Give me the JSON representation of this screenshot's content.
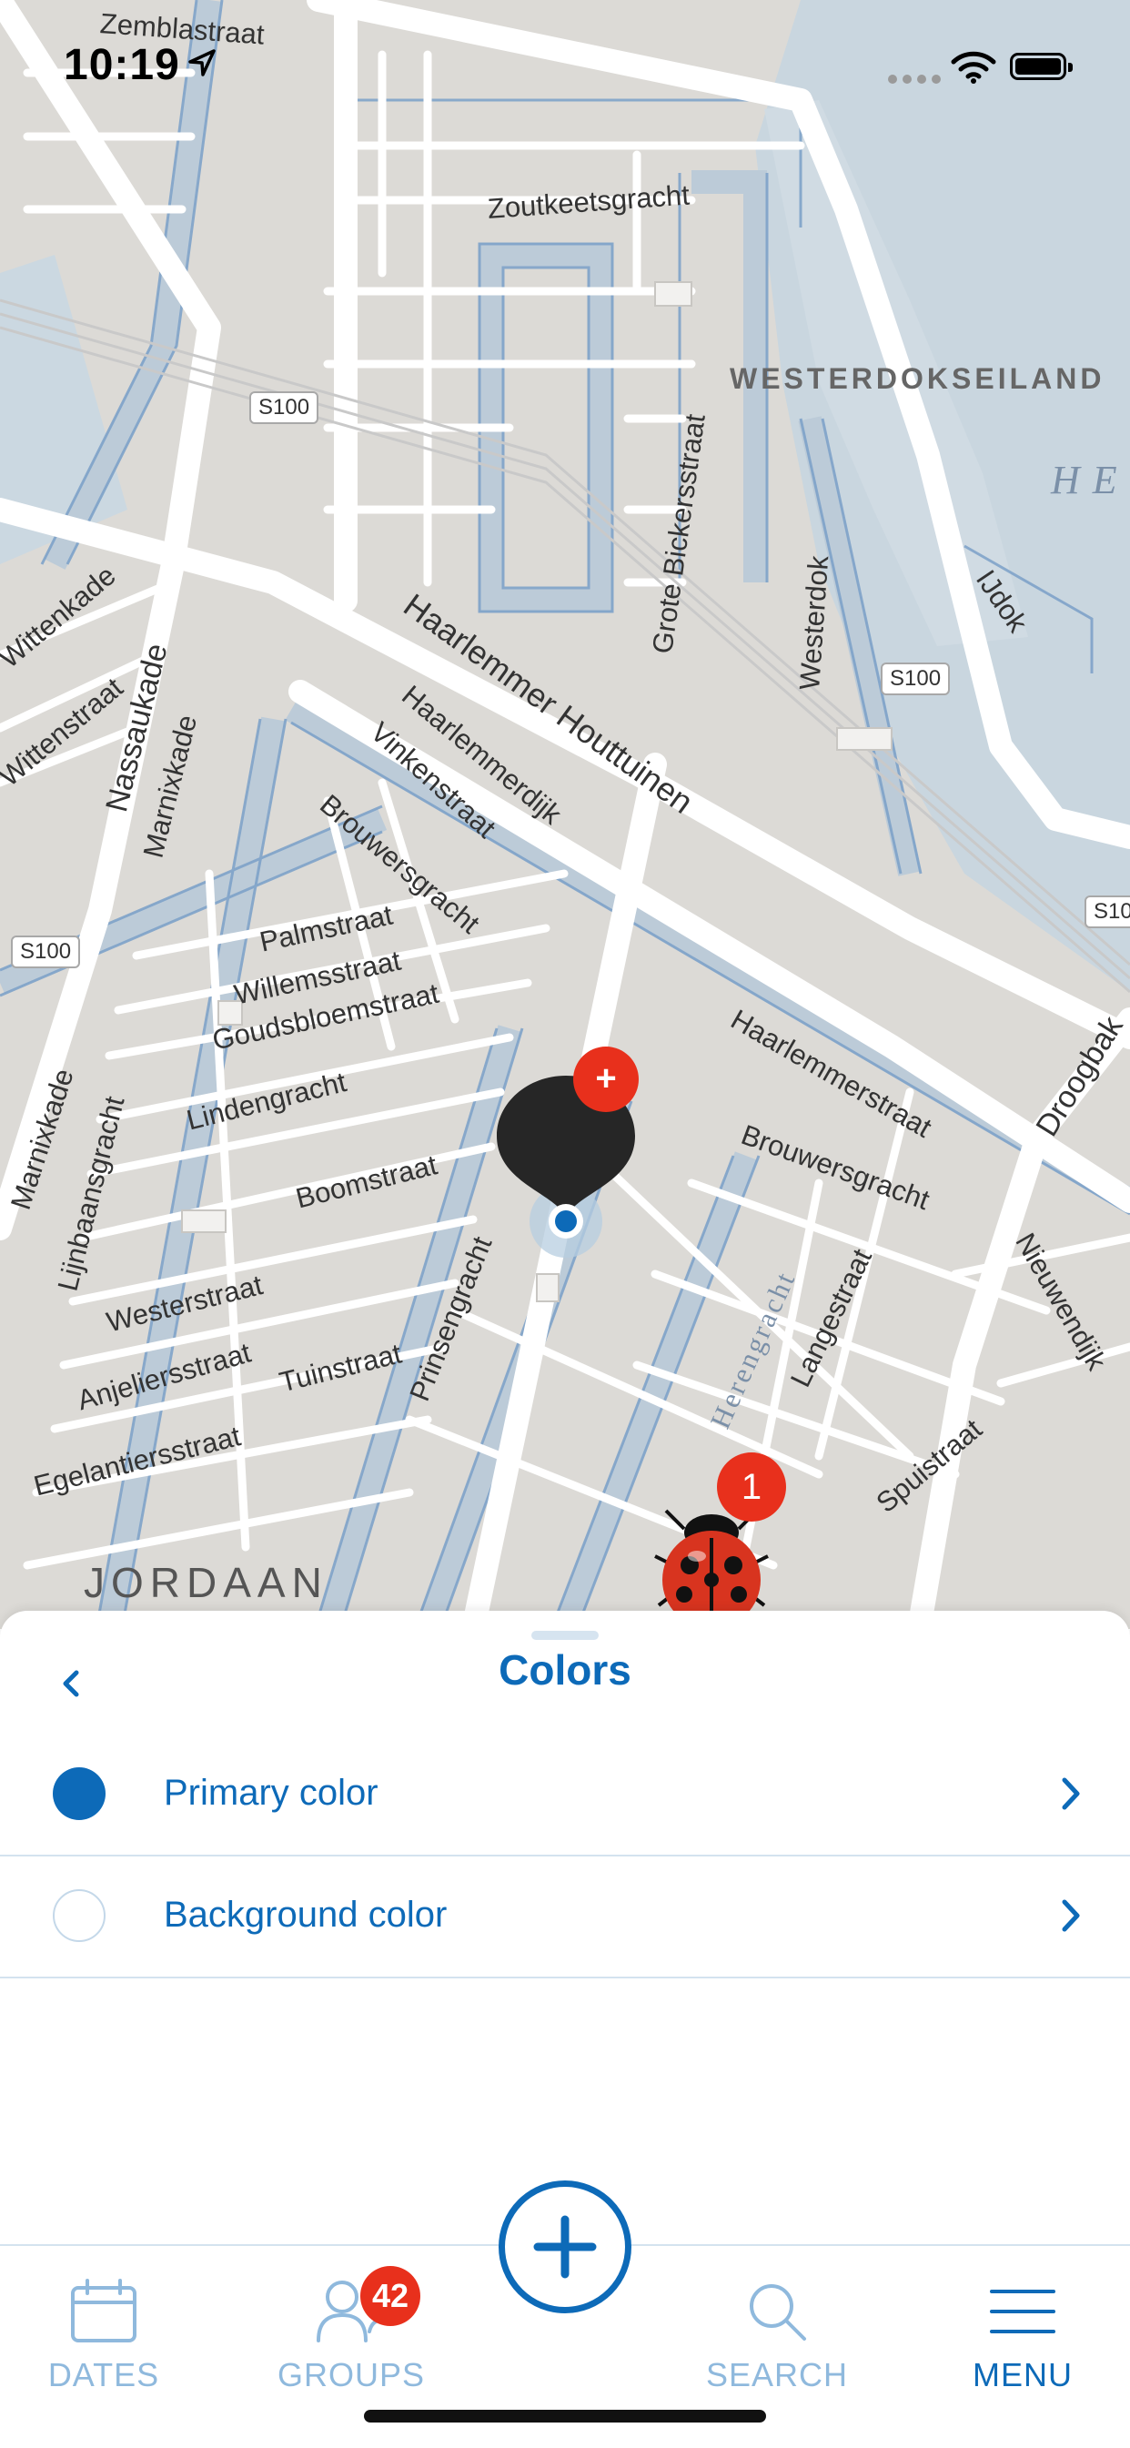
{
  "status_bar": {
    "time": "10:19"
  },
  "map": {
    "streets": [
      "Zoutkeetsgracht",
      "Grote Bickersstraat",
      "Westerdok",
      "IJdok",
      "Haarlemmer Houttuinen",
      "Haarlemmerdijk",
      "Vinkenstraat",
      "Brouwersgracht",
      "Palmstraat",
      "Willemsstraat",
      "Goudsbloemstraat",
      "Lindengracht",
      "Boomstraat",
      "Westerstraat",
      "Anjeliersstraat",
      "Tuinstraat",
      "Egelantiersstraat",
      "Prinsengracht",
      "Haarlemmerstraat",
      "Brouwersgracht",
      "Nieuwendijk",
      "Langestraat",
      "Spuistraat",
      "Herengracht",
      "Nassaukade",
      "Marnixkade",
      "Lijnbaansgracht",
      "Wittenkade",
      "Wittenstraat",
      "Droogbak",
      "Zemblastraat",
      "Marnixkade"
    ],
    "districts": {
      "jordaan": "JORDAAN",
      "westerdokseiland": "WESTERDOKSEILAND",
      "he": "HE"
    },
    "road_shield": "S100",
    "markers": {
      "user_badge": "+",
      "ladybug_count": "1"
    }
  },
  "sheet": {
    "title": "Colors",
    "items": [
      {
        "label": "Primary color",
        "swatch": "#0d6ab8"
      },
      {
        "label": "Background color",
        "swatch": "#ffffff"
      }
    ]
  },
  "tabbar": {
    "tabs": [
      {
        "label": "DATES",
        "icon": "calendar-icon"
      },
      {
        "label": "GROUPS",
        "icon": "person-icon",
        "badge": "42"
      },
      {
        "label": "SEARCH",
        "icon": "search-icon"
      },
      {
        "label": "MENU",
        "icon": "menu-icon",
        "active": true
      }
    ]
  },
  "colors": {
    "accent": "#0d6ab8",
    "badge": "#e8301c",
    "water": "#c6d5e0"
  }
}
